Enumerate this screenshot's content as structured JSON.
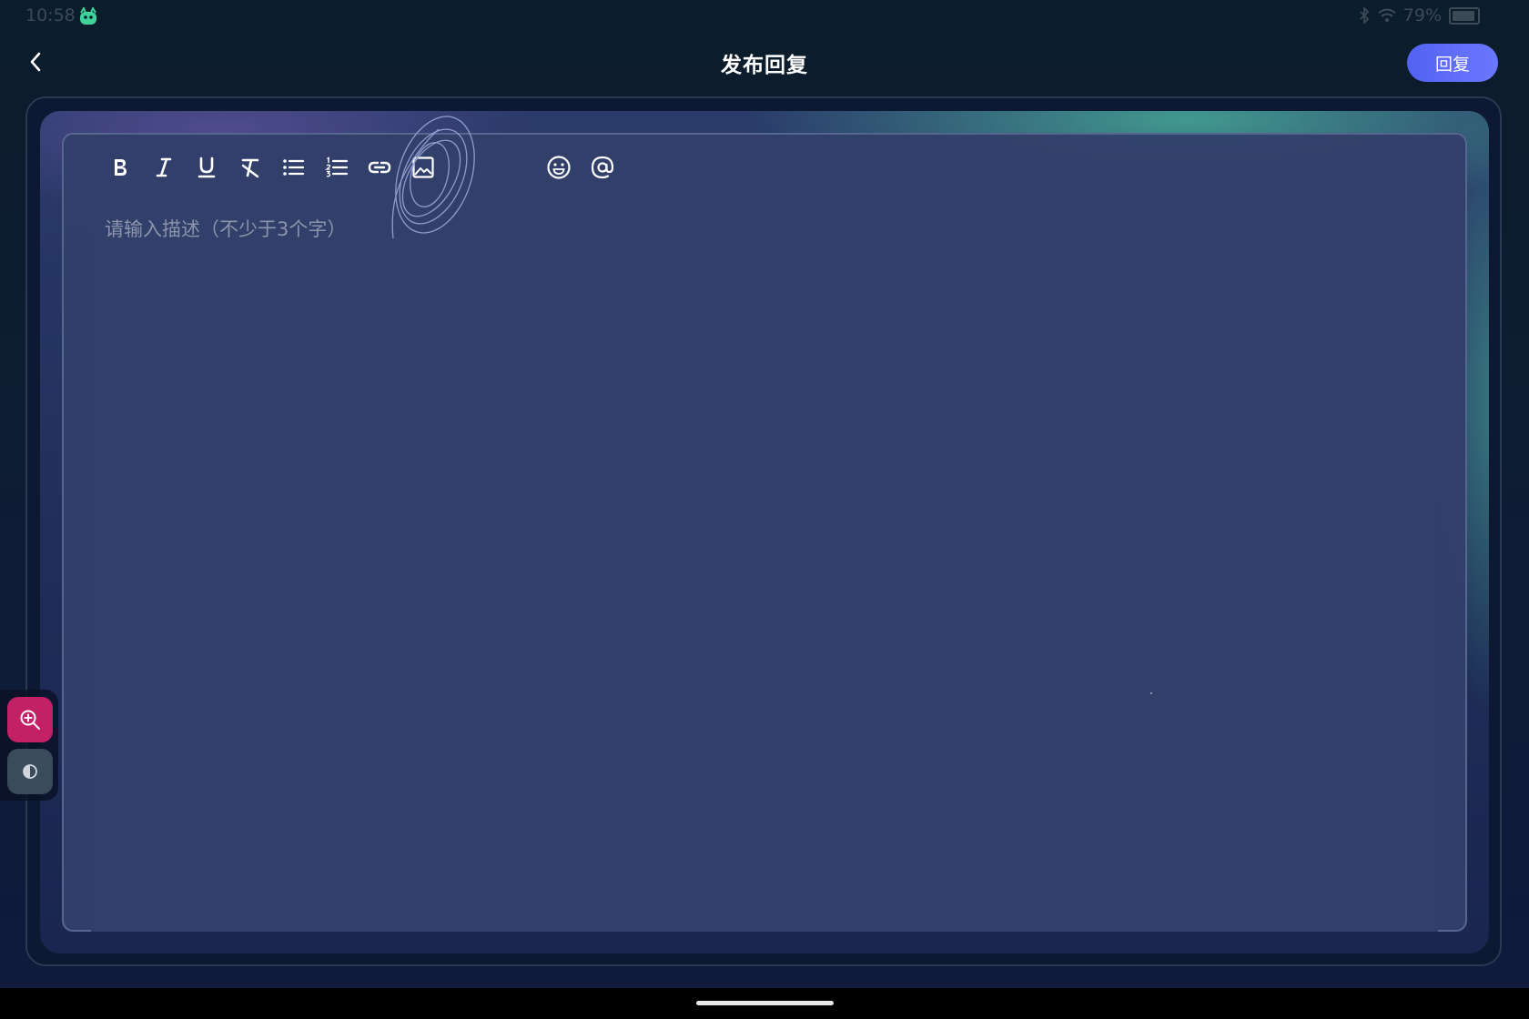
{
  "status_bar": {
    "time": "10:58",
    "battery": "79%",
    "icons": [
      "app-mascot-icon",
      "bluetooth-icon",
      "wifi-icon",
      "battery-icon"
    ]
  },
  "header": {
    "title": "发布回复",
    "reply_label": "回复",
    "back_icon": "chevron-left-icon"
  },
  "toolbar": {
    "tools": [
      {
        "name": "bold",
        "icon": "bold-icon"
      },
      {
        "name": "italic",
        "icon": "italic-icon"
      },
      {
        "name": "underline",
        "icon": "underline-icon"
      },
      {
        "name": "clear-format",
        "icon": "clear-format-icon"
      },
      {
        "name": "bullet-list",
        "icon": "bullet-list-icon"
      },
      {
        "name": "ordered-list",
        "icon": "ordered-list-icon"
      },
      {
        "name": "link",
        "icon": "link-icon"
      },
      {
        "name": "image",
        "icon": "image-icon"
      },
      {
        "name": "emoji",
        "icon": "emoji-icon"
      },
      {
        "name": "mention",
        "icon": "at-icon"
      }
    ]
  },
  "editor": {
    "placeholder": "请输入描述（不少于3个字）"
  },
  "side_tools": {
    "zoom_icon": "zoom-in-icon",
    "contrast_icon": "contrast-icon"
  },
  "colors": {
    "accent": "#5a68f5",
    "zoom_button": "#c42066",
    "editor_bg": "#31406a"
  }
}
